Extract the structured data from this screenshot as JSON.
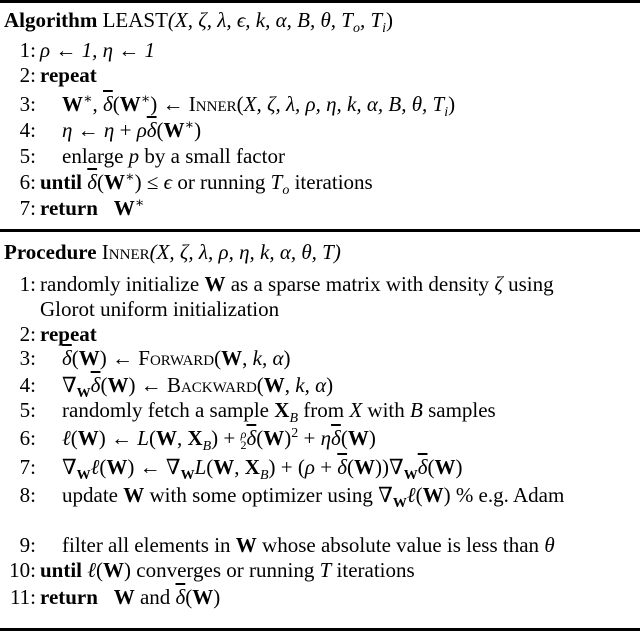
{
  "algorithm": {
    "keyword": "Algorithm",
    "signature": "LEAST(X, ζ, λ, ϵ, k, α, B, θ, Tₒ, Tᵢ)",
    "name": "LEAST",
    "params": "(X, ζ, λ, ϵ, k, α, B, θ, T",
    "lines": [
      {
        "num": "1:",
        "text": "ρ ← 1, η ← 1"
      },
      {
        "num": "2:",
        "keyword": "repeat",
        "text": ""
      },
      {
        "num": "3:",
        "text": "W*, δ̄(W*) ← Inner(X, ζ, λ, ρ, η, k, α, B, θ, Tᵢ)"
      },
      {
        "num": "4:",
        "text": "η ← η + ρδ̄(W*)"
      },
      {
        "num": "5:",
        "text": "enlarge p by a small factor"
      },
      {
        "num": "6:",
        "keyword": "until",
        "text": "δ̄(W*) ≤ ϵ or running Tₒ iterations"
      },
      {
        "num": "7:",
        "keyword": "return",
        "text": "W*"
      }
    ]
  },
  "procedure": {
    "keyword": "Procedure",
    "name": "Inner",
    "params": "(X, ζ, λ, ρ, η, k, α, θ, T)",
    "lines": [
      {
        "num": "1:",
        "text": "randomly initialize W as a sparse matrix with density ζ using",
        "cont": "Glorot uniform initialization"
      },
      {
        "num": "2:",
        "keyword": "repeat",
        "text": ""
      },
      {
        "num": "3:",
        "text": "δ̄(W) ← Forward(W, k, α)"
      },
      {
        "num": "4:",
        "text": "∇Wδ̄(W) ← Backward(W, k, α)"
      },
      {
        "num": "5:",
        "text": "randomly fetch a sample X_B from X with B samples"
      },
      {
        "num": "6:",
        "text": "ℓ(W) ← L(W, X_B) + ρ/2 δ̄(W)² + ηδ̄(W)"
      },
      {
        "num": "7:",
        "text": "∇Wℓ(W) ← ∇W L(W, X_B) + (ρ + δ̄(W))∇Wδ̄(W)"
      },
      {
        "num": "8:",
        "text": "update W with some optimizer using ∇Wℓ(W) % e.g. Adam"
      },
      {
        "num": "9:",
        "text": "filter all elements in W whose absolute value is less than θ"
      },
      {
        "num": "10:",
        "keyword": "until",
        "text": "ℓ(W) converges or running T iterations"
      },
      {
        "num": "11:",
        "keyword": "return",
        "text": "W and δ̄(W)"
      }
    ]
  },
  "words": {
    "enlarge": "enlarge",
    "by_small_factor": "by a small factor",
    "or_running": "or running",
    "iterations": "iterations",
    "randomly_initialize": "randomly initialize",
    "as_sparse": "as a sparse matrix with density",
    "using": "using",
    "glorot": "Glorot uniform initialization",
    "forward": "Forward",
    "backward": "Backward",
    "inner": "Inner",
    "randomly_fetch": "randomly fetch a sample",
    "from": "from",
    "with": "with",
    "samples": "samples",
    "update": "update",
    "with_optimizer": "with some optimizer using",
    "comment": "% e.g. Adam",
    "filter": "filter all elements in",
    "whose": "whose absolute value is less than",
    "converges": "converges or running",
    "and": "and"
  }
}
